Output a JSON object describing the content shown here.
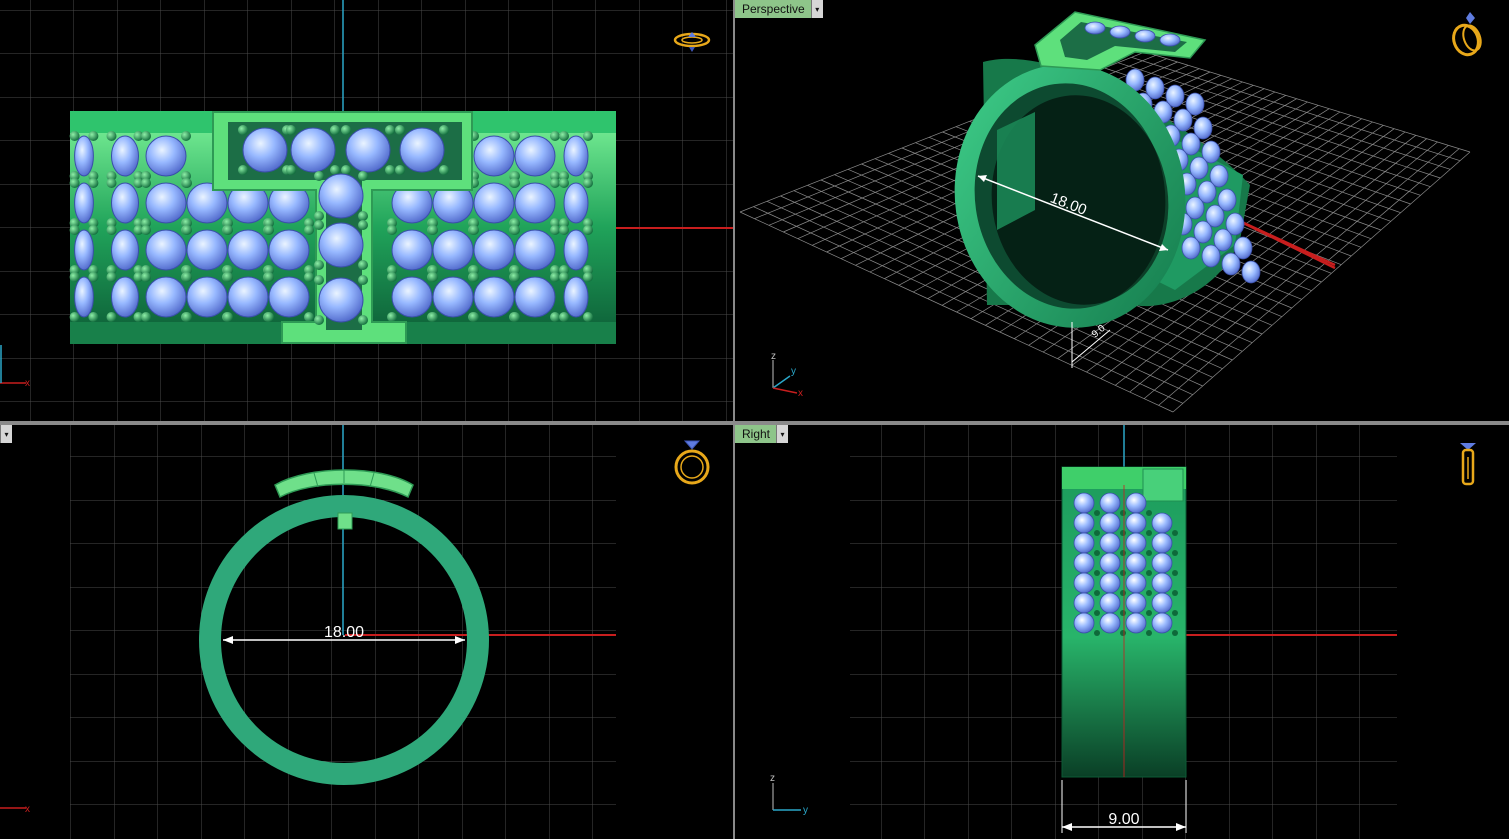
{
  "viewports": {
    "top": {
      "label": ""
    },
    "perspective": {
      "label": "Perspective",
      "dimension": "18.00",
      "dimension_small": "9.0"
    },
    "front": {
      "label": "",
      "dimension": "18.00"
    },
    "right": {
      "label": "Right",
      "dimension": "9.00"
    }
  },
  "axes": {
    "x": "x",
    "y": "y",
    "z": "z"
  },
  "dropdown_glyph": "▾",
  "icons": {
    "top": "ring-top-view-icon",
    "perspective": "ring-perspective-icon",
    "front": "ring-front-view-icon",
    "right": "ring-side-view-icon"
  },
  "colors": {
    "background": "#000000",
    "grid": "#4a4a4a",
    "ring_green": "#2fa87a",
    "ring_light": "#6fe08a",
    "stone": "#8fb6ff",
    "x_axis": "#c81e1e",
    "y_axis": "#2aa7c9",
    "dimension": "#ffffff",
    "icon": "#e8a81a"
  }
}
